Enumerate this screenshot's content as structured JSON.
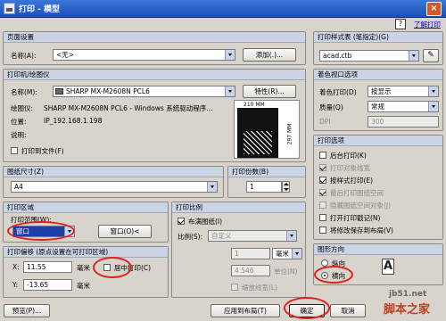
{
  "window": {
    "title": "打印 - 模型",
    "close": "×"
  },
  "help": {
    "icon": "?",
    "link": "了解打印"
  },
  "page_setup": {
    "header": "页面设置",
    "name_label": "名称(A):",
    "name_value": "<无>",
    "add_button": "添加(.)..."
  },
  "printer": {
    "header": "打印机/绘图仪",
    "name_label": "名称(M):",
    "name_value": "SHARP MX-M2608N PCL6",
    "props_button": "特性(R)...",
    "plotter_label": "绘图仪:",
    "plotter_value": "SHARP MX-M2608N PCL6 - Windows 系统驱动程序...",
    "location_label": "位置:",
    "location_value": "IP_192.168.1.198",
    "desc_label": "说明:",
    "print_to_file": "打印到文件(F)",
    "preview_width": "210 MM",
    "preview_height": "297 MM"
  },
  "plot_style": {
    "header": "打印样式表 (笔指定)(G)",
    "value": "acad.ctb"
  },
  "shaded": {
    "header": "着色视口选项",
    "shade_label": "着色打印(D)",
    "shade_value": "按显示",
    "quality_label": "质量(Q)",
    "quality_value": "常规",
    "dpi_label": "DPI",
    "dpi_value": "300"
  },
  "plot_options": {
    "header": "打印选项",
    "items": [
      {
        "label": "后台打印(K)",
        "checked": false,
        "enabled": true
      },
      {
        "label": "打印对象线宽",
        "checked": true,
        "enabled": false
      },
      {
        "label": "按样式打印(E)",
        "checked": true,
        "enabled": true
      },
      {
        "label": "最后打印图纸空间",
        "checked": true,
        "enabled": false
      },
      {
        "label": "隐藏图纸空间对象(J)",
        "checked": false,
        "enabled": false
      },
      {
        "label": "打开打印戳记(N)",
        "checked": false,
        "enabled": true
      },
      {
        "label": "将修改保存到布局(V)",
        "checked": false,
        "enabled": true
      }
    ]
  },
  "paper_size": {
    "header": "图纸尺寸(Z)",
    "value": "A4"
  },
  "copies": {
    "header": "打印份数(B)",
    "value": "1"
  },
  "plot_area": {
    "header": "打印区域",
    "range_label": "打印范围(W):",
    "range_value": "窗口",
    "window_button": "窗口(O)<"
  },
  "plot_offset": {
    "header": "打印偏移 (原点设置在可打印区域)",
    "x_label": "X:",
    "x_value": "11.55",
    "x_unit": "毫米",
    "y_label": "Y:",
    "y_value": "-13.65",
    "y_unit": "毫米",
    "center_label": "居中打印(C)"
  },
  "plot_scale": {
    "header": "打印比例",
    "fit_label": "布满图纸(I)",
    "scale_label": "比例(S):",
    "scale_value": "自定义",
    "val1": "1",
    "unit": "毫米",
    "val2": "4.546",
    "unit_label": "单位(N)",
    "lineweight_label": "缩放线宽(L)"
  },
  "orientation": {
    "header": "图形方向",
    "portrait": "纵向",
    "landscape": "横向"
  },
  "footer": {
    "preview": "预览(P)...",
    "apply": "应用到布局(T)",
    "ok": "确定",
    "cancel": "取消"
  },
  "watermark": {
    "line1": "jb51.net",
    "line2": "脚本之家"
  }
}
